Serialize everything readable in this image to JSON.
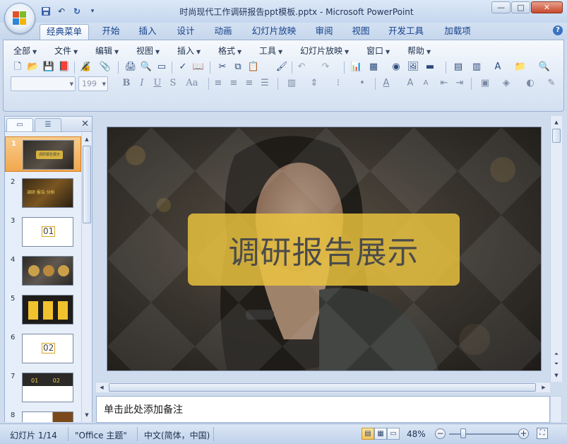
{
  "window": {
    "title": "时尚现代工作调研报告ppt模板.pptx - Microsoft PowerPoint",
    "buttons": {
      "minimize": "—",
      "maximize": "□",
      "close": "✕"
    }
  },
  "quick_access": [
    {
      "name": "save",
      "glyph": "💾"
    },
    {
      "name": "undo",
      "glyph": "↶"
    },
    {
      "name": "redo",
      "glyph": "↷"
    },
    {
      "name": "customize",
      "glyph": "▾"
    }
  ],
  "ribbon_tabs": [
    "经典菜单",
    "开始",
    "插入",
    "设计",
    "动画",
    "幻灯片放映",
    "审阅",
    "视图",
    "开发工具",
    "加载项"
  ],
  "active_tab": "经典菜单",
  "help": "?",
  "menu": [
    "全部",
    "文件",
    "编辑",
    "视图",
    "插入",
    "格式",
    "工具",
    "幻灯片放映",
    "窗口",
    "帮助"
  ],
  "toolbar": {
    "font_name": "",
    "font_size": "199",
    "format_buttons": [
      "B",
      "I",
      "U",
      "S",
      "Aa"
    ]
  },
  "left_pane": {
    "tabs": [
      "slides",
      "outline"
    ],
    "close": "✕",
    "thumbnails": [
      {
        "num": "1",
        "label": "调研报告展示",
        "selected": true
      },
      {
        "num": "2",
        "label": "调研·报告·分析",
        "selected": false
      },
      {
        "num": "3",
        "label": "01",
        "selected": false
      },
      {
        "num": "4",
        "label": "",
        "selected": false
      },
      {
        "num": "5",
        "label": "",
        "selected": false
      },
      {
        "num": "6",
        "label": "02",
        "selected": false
      },
      {
        "num": "7",
        "label": "01 02",
        "selected": false
      },
      {
        "num": "8",
        "label": "",
        "selected": false
      }
    ]
  },
  "slide": {
    "title": "调研报告展示",
    "colors": {
      "accent": "#eec63e",
      "overlay": "#3a3a3a"
    }
  },
  "notes": {
    "placeholder": "单击此处添加备注"
  },
  "status": {
    "slide": "幻灯片 1/14",
    "theme": "\"Office 主题\"",
    "language": "中文(简体，中国)",
    "zoom": "48%",
    "zoom_level": 0.48
  }
}
